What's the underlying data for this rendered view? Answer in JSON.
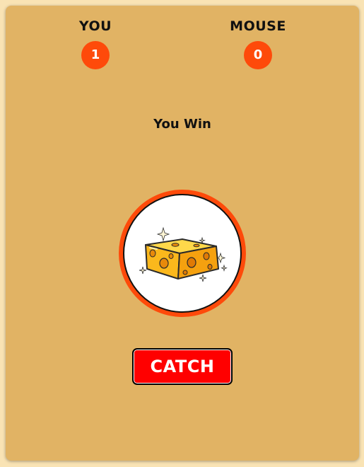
{
  "scoreboard": {
    "player_label": "YOU",
    "player_score": "1",
    "opponent_label": "MOUSE",
    "opponent_score": "0"
  },
  "result_text": "You Win",
  "target": {
    "icon": "cheese-icon"
  },
  "catch_button_label": "CATCH",
  "colors": {
    "page_background": "#f9e3b4",
    "panel_background": "#e1b364",
    "score_badge": "#fe4a0a",
    "target_ring": "#fe4a0a",
    "catch_button": "#ff0000",
    "cheese": "#fbb81c"
  }
}
